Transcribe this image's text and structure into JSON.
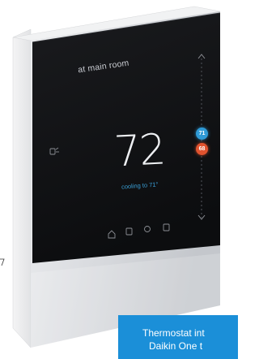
{
  "product": {
    "room_label": "at main room",
    "current_temp": "72",
    "status_text": "cooling to 71°",
    "cool_setpoint": "71",
    "heat_setpoint": "68",
    "icons": [
      "home-icon",
      "schedule-icon",
      "fan-icon",
      "menu-icon"
    ]
  },
  "caption": {
    "line1": "Thermostat int",
    "line2": "Daikin One t"
  },
  "colors": {
    "screen": "#101114",
    "cool": "#2f9ad6",
    "heat": "#e0522e",
    "caption_bg": "#1b8fd8"
  }
}
